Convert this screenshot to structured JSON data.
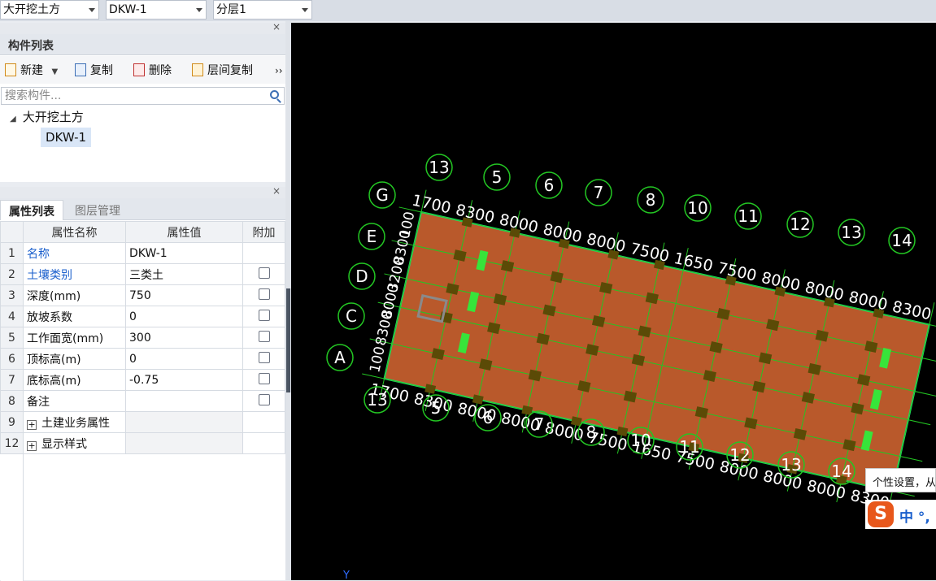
{
  "topbar": {
    "type_combo": "大开挖土方",
    "name_combo": "DKW-1",
    "layer_combo": "分层1"
  },
  "component_panel": {
    "title": "构件列表",
    "close": "×",
    "toolbar": {
      "new": "新建",
      "copy": "复制",
      "delete": "删除",
      "floor_copy": "层间复制",
      "more": "››"
    },
    "search_placeholder": "搜索构件...",
    "tree": {
      "group": "大开挖土方",
      "item": "DKW-1"
    }
  },
  "property_panel": {
    "close": "×",
    "tabs": [
      "属性列表",
      "图层管理"
    ],
    "headers": {
      "name": "属性名称",
      "value": "属性值",
      "extra": "附加"
    },
    "rows": [
      {
        "num": "1",
        "name": "名称",
        "value": "DKW-1",
        "checkbox": false,
        "blue": true
      },
      {
        "num": "2",
        "name": "土壤类别",
        "value": "三类土",
        "checkbox": true,
        "blue": true
      },
      {
        "num": "3",
        "name": "深度(mm)",
        "value": "750",
        "checkbox": true,
        "blue": false
      },
      {
        "num": "4",
        "name": "放坡系数",
        "value": "0",
        "checkbox": true,
        "blue": false
      },
      {
        "num": "5",
        "name": "工作面宽(mm)",
        "value": "300",
        "checkbox": true,
        "blue": false
      },
      {
        "num": "6",
        "name": "顶标高(m)",
        "value": "0",
        "checkbox": true,
        "blue": false
      },
      {
        "num": "7",
        "name": "底标高(m)",
        "value": "-0.75",
        "checkbox": true,
        "blue": false
      },
      {
        "num": "8",
        "name": "备注",
        "value": "",
        "checkbox": true,
        "blue": false
      },
      {
        "num": "9",
        "name": "土建业务属性",
        "value": "",
        "checkbox": false,
        "blue": false,
        "expandable": true,
        "expander": "+"
      },
      {
        "num": "12",
        "name": "显示样式",
        "value": "",
        "checkbox": false,
        "blue": false,
        "expandable": true,
        "expander": "+"
      }
    ]
  },
  "canvas": {
    "top_axis_labels": [
      "13",
      "5",
      "6",
      "7",
      "8",
      "10",
      "11",
      "12",
      "13",
      "14"
    ],
    "bottom_axis_labels": [
      "13",
      "5",
      "6",
      "7",
      "8",
      "10",
      "11",
      "12",
      "13",
      "14"
    ],
    "left_axis_labels": [
      "G",
      "E",
      "D",
      "C",
      "A"
    ],
    "top_dims": [
      "1700",
      "8300",
      "8000",
      "8000",
      "8000",
      "7500",
      "1650",
      "7500",
      "8000",
      "8000",
      "8000",
      "8300"
    ],
    "bottom_dims": [
      "1700",
      "8300",
      "8000",
      "8000",
      "8000",
      "7500",
      "1650",
      "7500",
      "8000",
      "8000",
      "8000",
      "8300"
    ],
    "left_dims": [
      "100",
      "8300",
      "8000",
      "3200",
      "8300",
      "100"
    ],
    "axis_indicator": "Y",
    "colors": {
      "background": "#000000",
      "excavation_fill": "#b9592b",
      "outline": "#1fe07a",
      "grid": "#23c623",
      "column": "#5b4a06",
      "green_mark": "#37e43a"
    }
  },
  "ime": {
    "tooltip": "个性设置，从",
    "logo": "S",
    "mode": "中 °,"
  }
}
